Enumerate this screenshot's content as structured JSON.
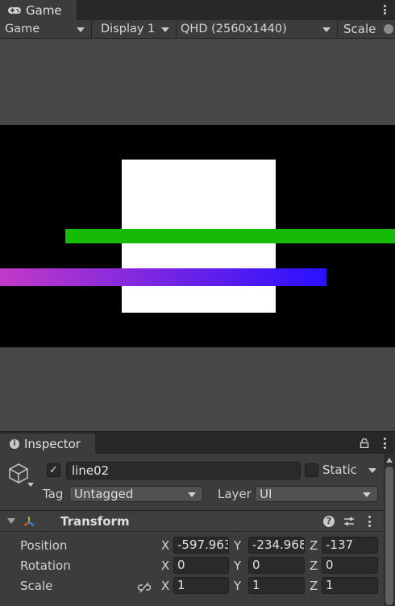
{
  "game_window": {
    "tab_label": "Game",
    "tab_icon": "gamepad-icon",
    "toolbar": {
      "view_mode": "Game",
      "display": "Display 1",
      "resolution": "QHD (2560x1440)",
      "scale_label": "Scale"
    },
    "colors": {
      "canvas_background": "#000000",
      "square": "#ffffff",
      "green_line": "#15bb07",
      "gradient_line_start": "#c23ac8",
      "gradient_line_end": "#2a10ff"
    }
  },
  "inspector": {
    "tab_label": "Inspector",
    "tab_icon": "info-icon",
    "header_icons": [
      "lock-icon",
      "kebab-menu-icon"
    ],
    "object": {
      "icon": "cube-icon",
      "active": true,
      "name": "line02",
      "static": false,
      "static_label": "Static",
      "tag_label": "Tag",
      "tag_value": "Untagged",
      "layer_label": "Layer",
      "layer_value": "UI"
    },
    "transform": {
      "title": "Transform",
      "icon": "transform-axes-icon",
      "header_icons": [
        "help-icon",
        "preset-icon",
        "kebab-menu-icon"
      ],
      "position": {
        "label": "Position",
        "x": "-597.963",
        "y": "-234.968",
        "z": "-137"
      },
      "rotation": {
        "label": "Rotation",
        "x": "0",
        "y": "0",
        "z": "0"
      },
      "scale": {
        "label": "Scale",
        "x": "1",
        "y": "1",
        "z": "1"
      },
      "axis_labels": {
        "x": "X",
        "y": "Y",
        "z": "Z"
      }
    }
  }
}
